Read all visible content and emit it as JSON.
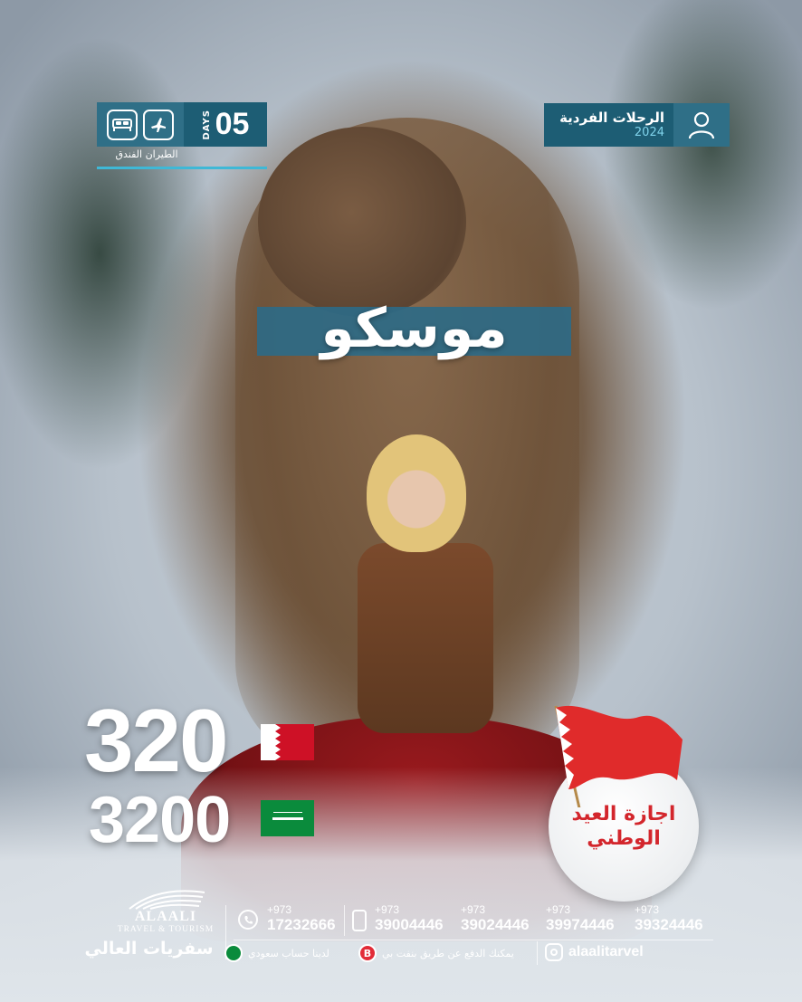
{
  "header": {
    "duration": {
      "days_word": "DAYS",
      "days_number": "05",
      "caption": "الطيران  الفندق",
      "icons": [
        "hotel-bed-icon",
        "airplane-icon"
      ]
    },
    "trip_type": {
      "title": "الرحلات الفردية",
      "year": "2024",
      "icon": "user-icon"
    }
  },
  "destination": "موسكو",
  "prices": [
    {
      "amount": "320",
      "currency_flag": "bahrain-flag"
    },
    {
      "amount": "3200",
      "currency_flag": "saudi-flag"
    }
  ],
  "holiday_badge": {
    "line1": "اجازة العيد",
    "line2": "الوطني",
    "flag": "bahrain-flag"
  },
  "footer": {
    "logo": {
      "name": "ALAALI",
      "subtitle": "TRAVEL & TOURISM",
      "arabic": "سفريات العالي"
    },
    "landline": {
      "cc": "+973",
      "number": "17232666"
    },
    "mobiles": [
      {
        "cc": "+973",
        "number": "39004446"
      },
      {
        "cc": "+973",
        "number": "39024446"
      },
      {
        "cc": "+973",
        "number": "39974446"
      },
      {
        "cc": "+973",
        "number": "39324446"
      }
    ],
    "saudi_account": "لدينا حساب سعودي",
    "benefit_pay": "يمكنك الدفع عن طريق بنفت بي",
    "instagram": "alaalitarvel"
  },
  "colors": {
    "primary": "#1d5d74",
    "secondary": "#2f6f87",
    "accent": "#3fb8d6",
    "red": "#d3262c",
    "saudi_green": "#0a8b3c"
  }
}
